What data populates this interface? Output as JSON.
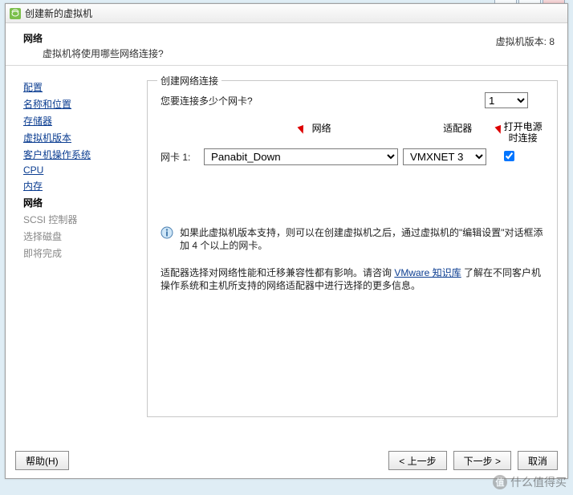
{
  "window": {
    "title": "创建新的虚拟机"
  },
  "header": {
    "title": "网络",
    "subtitle": "虚拟机将使用哪些网络连接?",
    "version_label": "虚拟机版本: 8"
  },
  "sidebar": {
    "items": [
      {
        "label": "配置",
        "state": "link"
      },
      {
        "label": "名称和位置",
        "state": "link"
      },
      {
        "label": "存储器",
        "state": "link"
      },
      {
        "label": "虚拟机版本",
        "state": "link"
      },
      {
        "label": "客户机操作系统",
        "state": "link"
      },
      {
        "label": "CPU",
        "state": "link"
      },
      {
        "label": "内存",
        "state": "link"
      },
      {
        "label": "网络",
        "state": "current"
      },
      {
        "label": "SCSI 控制器",
        "state": "disabled"
      },
      {
        "label": "选择磁盘",
        "state": "disabled"
      },
      {
        "label": "即将完成",
        "state": "disabled"
      }
    ]
  },
  "group": {
    "legend": "创建网络连接",
    "nic_count_question": "您要连接多少个网卡?",
    "nic_count_value": "1",
    "columns": {
      "network": "网络",
      "adapter": "适配器",
      "power_on": "打开电源时连接"
    },
    "nic_row": {
      "label": "网卡 1:",
      "network_value": "Panabit_Down",
      "adapter_value": "VMXNET 3",
      "connect_checked": true
    },
    "info": "如果此虚拟机版本支持，则可以在创建虚拟机之后，通过虚拟机的\"编辑设置\"对话框添加 4 个以上的网卡。",
    "note_prefix": "适配器选择对网络性能和迁移兼容性都有影响。请咨询 ",
    "note_link": "VMware 知识库",
    "note_suffix": " 了解在不同客户机操作系统和主机所支持的网络适配器中进行选择的更多信息。"
  },
  "buttons": {
    "help": "帮助(H)",
    "back": "< 上一步",
    "next": "下一步 >",
    "cancel": "取消"
  },
  "watermark": {
    "text": "什么值得买"
  },
  "win_controls": {
    "min": "–",
    "max": "□",
    "close": "×"
  }
}
